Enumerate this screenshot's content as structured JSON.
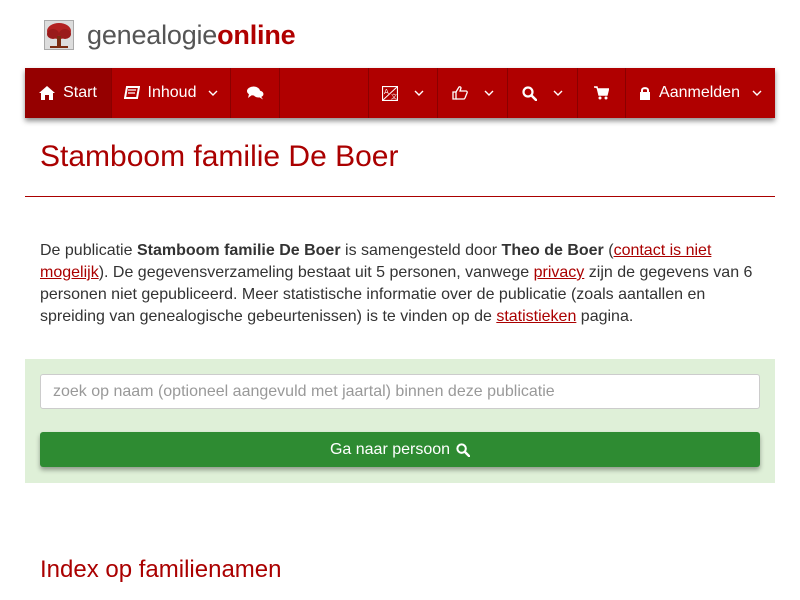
{
  "brand": {
    "name_part1": "genealogie",
    "name_part2": "online"
  },
  "nav": {
    "start_label": "Start",
    "inhoud_label": "Inhoud",
    "aanmelden_label": "Aanmelden"
  },
  "page": {
    "title": "Stamboom familie De Boer",
    "intro": {
      "t1": "De publicatie ",
      "pub_name": "Stamboom familie De Boer",
      "t2": " is samengesteld door ",
      "author": "Theo de Boer",
      "t3": " (",
      "contact_link": "contact is niet mogelijk",
      "t4": "). De gegevensverzameling bestaat uit 5 personen, vanwege ",
      "privacy_link": "privacy",
      "t5": " zijn de gegevens van 6 personen niet gepubliceerd. Meer statistische informatie over de publicatie (zoals aantallen en spreiding van genealogische gebeurtenissen) is te vinden op de ",
      "stats_link": "statistieken",
      "t6": " pagina."
    },
    "index_heading": "Index op familienamen"
  },
  "search": {
    "placeholder": "zoek op naam (optioneel aangevuld met jaartal) binnen deze publicatie",
    "value": "",
    "button_label": "Ga naar persoon"
  },
  "colors": {
    "brand_red": "#b00000",
    "success_green": "#2e8b32",
    "search_bg": "#dff0d8"
  },
  "icons": [
    "tree-logo-icon",
    "home-icon",
    "book-icon",
    "comments-icon",
    "language-icon",
    "thumbs-up-icon",
    "search-icon",
    "cart-icon",
    "lock-icon",
    "chevron-down-icon"
  ]
}
